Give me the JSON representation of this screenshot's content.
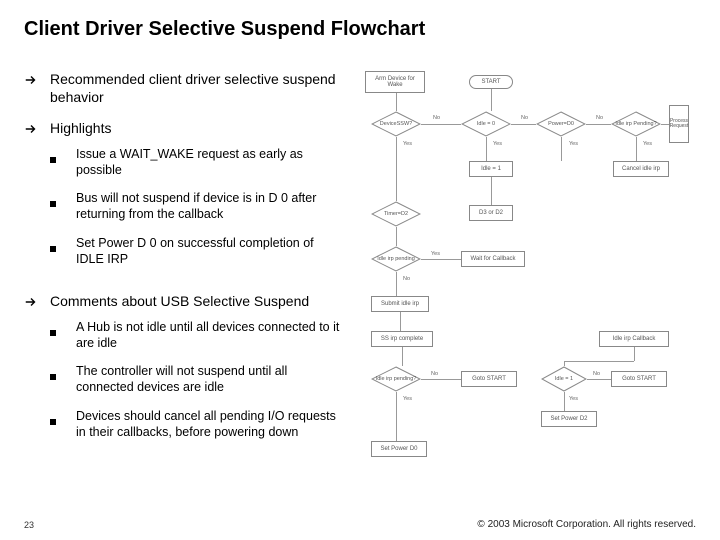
{
  "title": "Client Driver Selective Suspend Flowchart",
  "sections": [
    {
      "text": "Recommended client driver selective suspend behavior",
      "sub": []
    },
    {
      "text": "Highlights",
      "sub": [
        "Issue a WAIT_WAKE request as early as possible",
        "Bus will not suspend if device is in D 0 after returning from the callback",
        "Set Power D 0 on successful completion of IDLE IRP"
      ]
    },
    {
      "text": "Comments about USB Selective Suspend",
      "sub": [
        "A Hub is not idle until all devices connected to it are idle",
        "The controller will not suspend until all connected devices are idle",
        "Devices should cancel all pending I/O requests in their callbacks, before powering down"
      ]
    }
  ],
  "slide_number": "23",
  "copyright": "© 2003 Microsoft Corporation. All rights reserved.",
  "flow": {
    "start": "START",
    "arm": "Arm Device for Wake",
    "d_ssw": "DeviceSSW?",
    "d_idle0": "Idle = 0",
    "d_power_d0": "Power=D0",
    "d_idleirp": "Idle irp Pending?",
    "process_req": "Process Request",
    "idle1": "Idle = 1",
    "cancel_idle": "Cancel idle irp",
    "d_timerd2": "Timer=D2",
    "d3_d2": "D3 or D2",
    "d_idleirp2": "Idle irp pending",
    "wait_callback": "Wait for Callback",
    "submit_idle": "Submit idle irp",
    "ss_complete": "SS irp complete",
    "idle_irp_callback": "Idle irp Callback",
    "d_idleirp3": "Idle irp pending?",
    "goto_start": "Goto START",
    "d_idle1": "Idle = 1",
    "set_power_d0": "Set Power D0",
    "set_power_d2": "Set Power D2",
    "yes": "Yes",
    "no": "No"
  }
}
